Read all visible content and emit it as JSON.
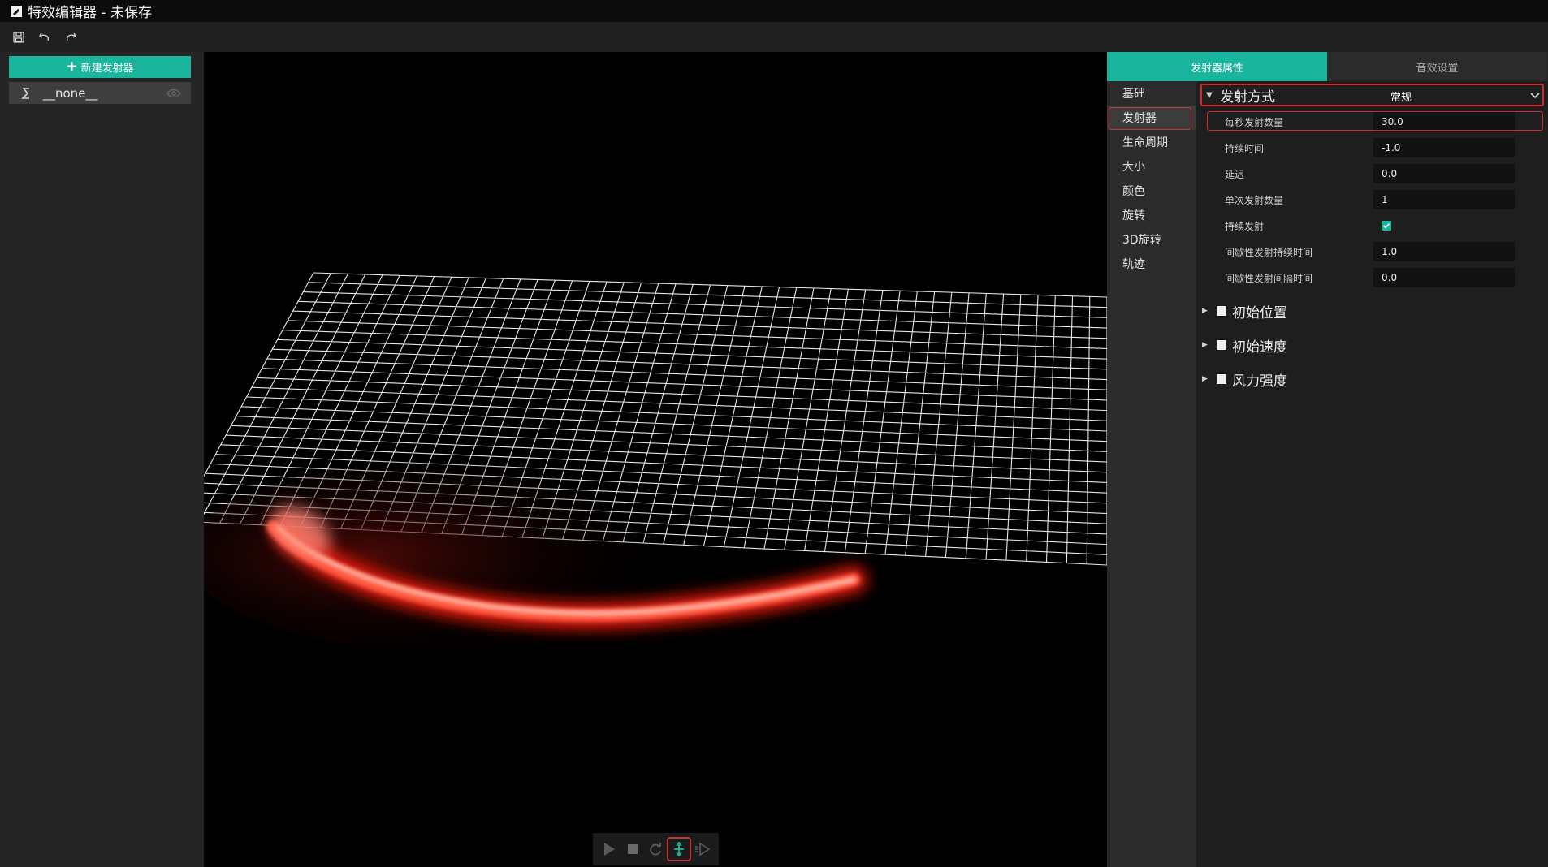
{
  "window": {
    "title": "特效编辑器 - 未保存",
    "icon": "app-logo-icon"
  },
  "toolbar": {
    "buttons": [
      "save-icon",
      "undo-icon",
      "redo-icon"
    ]
  },
  "left_panel": {
    "new_emitter_label": "新建发射器",
    "emitters": [
      {
        "name": "__none__",
        "icon": "emitter-s-icon",
        "visible": true
      }
    ]
  },
  "viewport": {
    "playback_buttons": [
      "play-icon",
      "stop-icon",
      "loop-icon",
      "center-icon",
      "step-icon"
    ],
    "active_button": "center-icon"
  },
  "right_panel": {
    "tabs": [
      {
        "label": "发射器属性",
        "active": true
      },
      {
        "label": "音效设置",
        "active": false
      }
    ],
    "categories": [
      "基础",
      "发射器",
      "生命周期",
      "大小",
      "颜色",
      "旋转",
      "3D旋转",
      "轨迹"
    ],
    "selected_category": "发射器",
    "section": {
      "label": "发射方式",
      "mode_value": "常规"
    },
    "properties": [
      {
        "label": "每秒发射数量",
        "value": "30.0",
        "type": "input"
      },
      {
        "label": "持续时间",
        "value": "-1.0",
        "type": "input"
      },
      {
        "label": "延迟",
        "value": "0.0",
        "type": "input"
      },
      {
        "label": "单次发射数量",
        "value": "1",
        "type": "input"
      },
      {
        "label": "持续发射",
        "value": "",
        "type": "checkbox",
        "checked": true
      },
      {
        "label": "间歇性发射持续时间",
        "value": "1.0",
        "type": "input"
      },
      {
        "label": "间歇性发射间隔时间",
        "value": "0.0",
        "type": "input"
      }
    ],
    "groups": [
      "初始位置",
      "初始速度",
      "风力强度"
    ]
  },
  "colors": {
    "accent": "#19b59d",
    "highlight": "#d3272d",
    "particle": "#ff3a2a"
  }
}
